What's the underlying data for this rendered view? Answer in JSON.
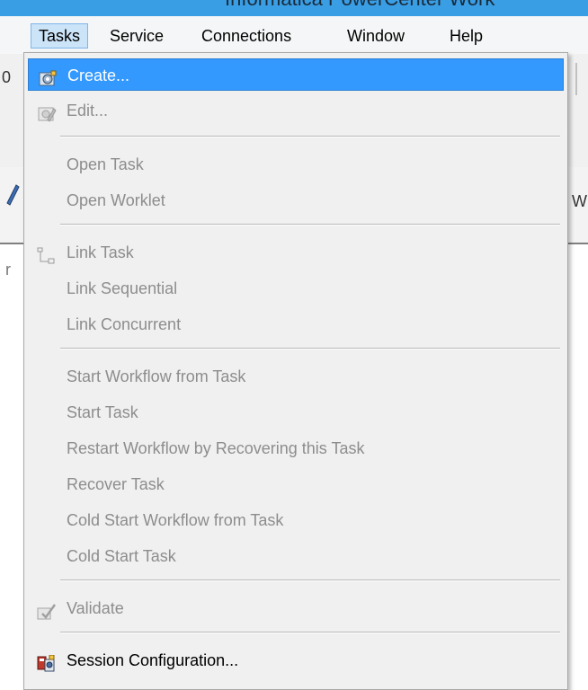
{
  "window": {
    "title_fragment": "Informatica PowerCenter Work"
  },
  "menubar": {
    "items": [
      {
        "label": "Tasks",
        "open": true
      },
      {
        "label": "Service"
      },
      {
        "label": "Connections"
      },
      {
        "label": "Window"
      },
      {
        "label": "Help"
      }
    ]
  },
  "background": {
    "frag_zero": "0",
    "frag_w": "W",
    "frag_r": "r"
  },
  "tasks_menu": {
    "items": [
      {
        "label": "Create...",
        "icon": "create-task-icon",
        "state": "highlighted"
      },
      {
        "label": "Edit...",
        "icon": "edit-task-icon",
        "state": "disabled"
      },
      {
        "label": "Open Task",
        "state": "disabled"
      },
      {
        "label": "Open Worklet",
        "state": "disabled"
      },
      {
        "label": "Link Task",
        "icon": "link-task-icon",
        "state": "disabled"
      },
      {
        "label": "Link Sequential",
        "state": "disabled"
      },
      {
        "label": "Link Concurrent",
        "state": "disabled"
      },
      {
        "label": "Start Workflow from Task",
        "state": "disabled"
      },
      {
        "label": "Start Task",
        "state": "disabled"
      },
      {
        "label": "Restart Workflow by Recovering this Task",
        "state": "disabled"
      },
      {
        "label": "Recover Task",
        "state": "disabled"
      },
      {
        "label": "Cold Start Workflow from Task",
        "state": "disabled"
      },
      {
        "label": "Cold Start Task",
        "state": "disabled"
      },
      {
        "label": "Validate",
        "icon": "validate-icon",
        "state": "disabled"
      },
      {
        "label": "Session Configuration...",
        "icon": "session-config-icon",
        "state": "enabled"
      }
    ]
  },
  "colors": {
    "highlight": "#3399ff",
    "menu_bg": "#f0f0f0",
    "disabled_text": "#8d8d8d",
    "titlebar": "#3a9ee4"
  }
}
